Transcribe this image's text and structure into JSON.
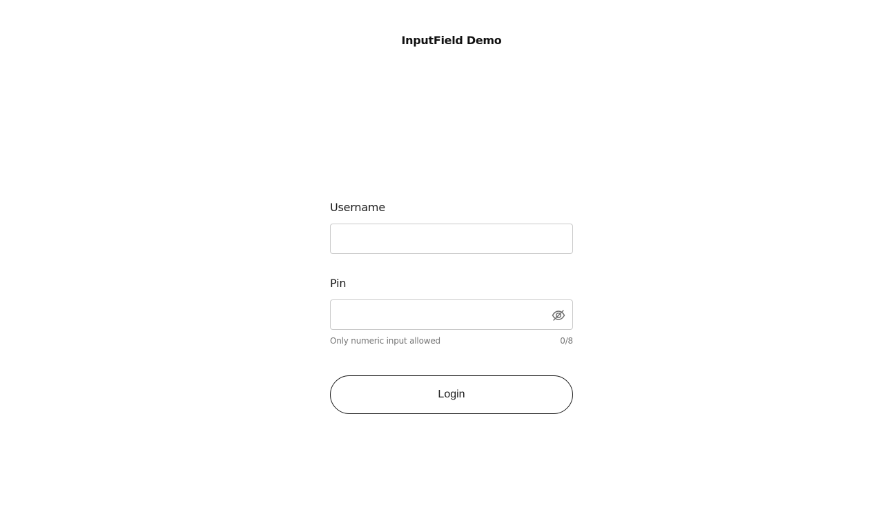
{
  "header": {
    "title": "InputField Demo"
  },
  "form": {
    "username": {
      "label": "Username",
      "value": "",
      "placeholder": ""
    },
    "pin": {
      "label": "Pin",
      "value": "",
      "placeholder": "",
      "visibility_icon": "eye-slash-icon",
      "helper_text": "Only numeric input allowed",
      "counter": "0/8"
    },
    "login_label": "Login"
  },
  "colors": {
    "border": "#c9c9c9",
    "text": "#1a1a1a",
    "helper": "#757575",
    "background": "#ffffff"
  }
}
